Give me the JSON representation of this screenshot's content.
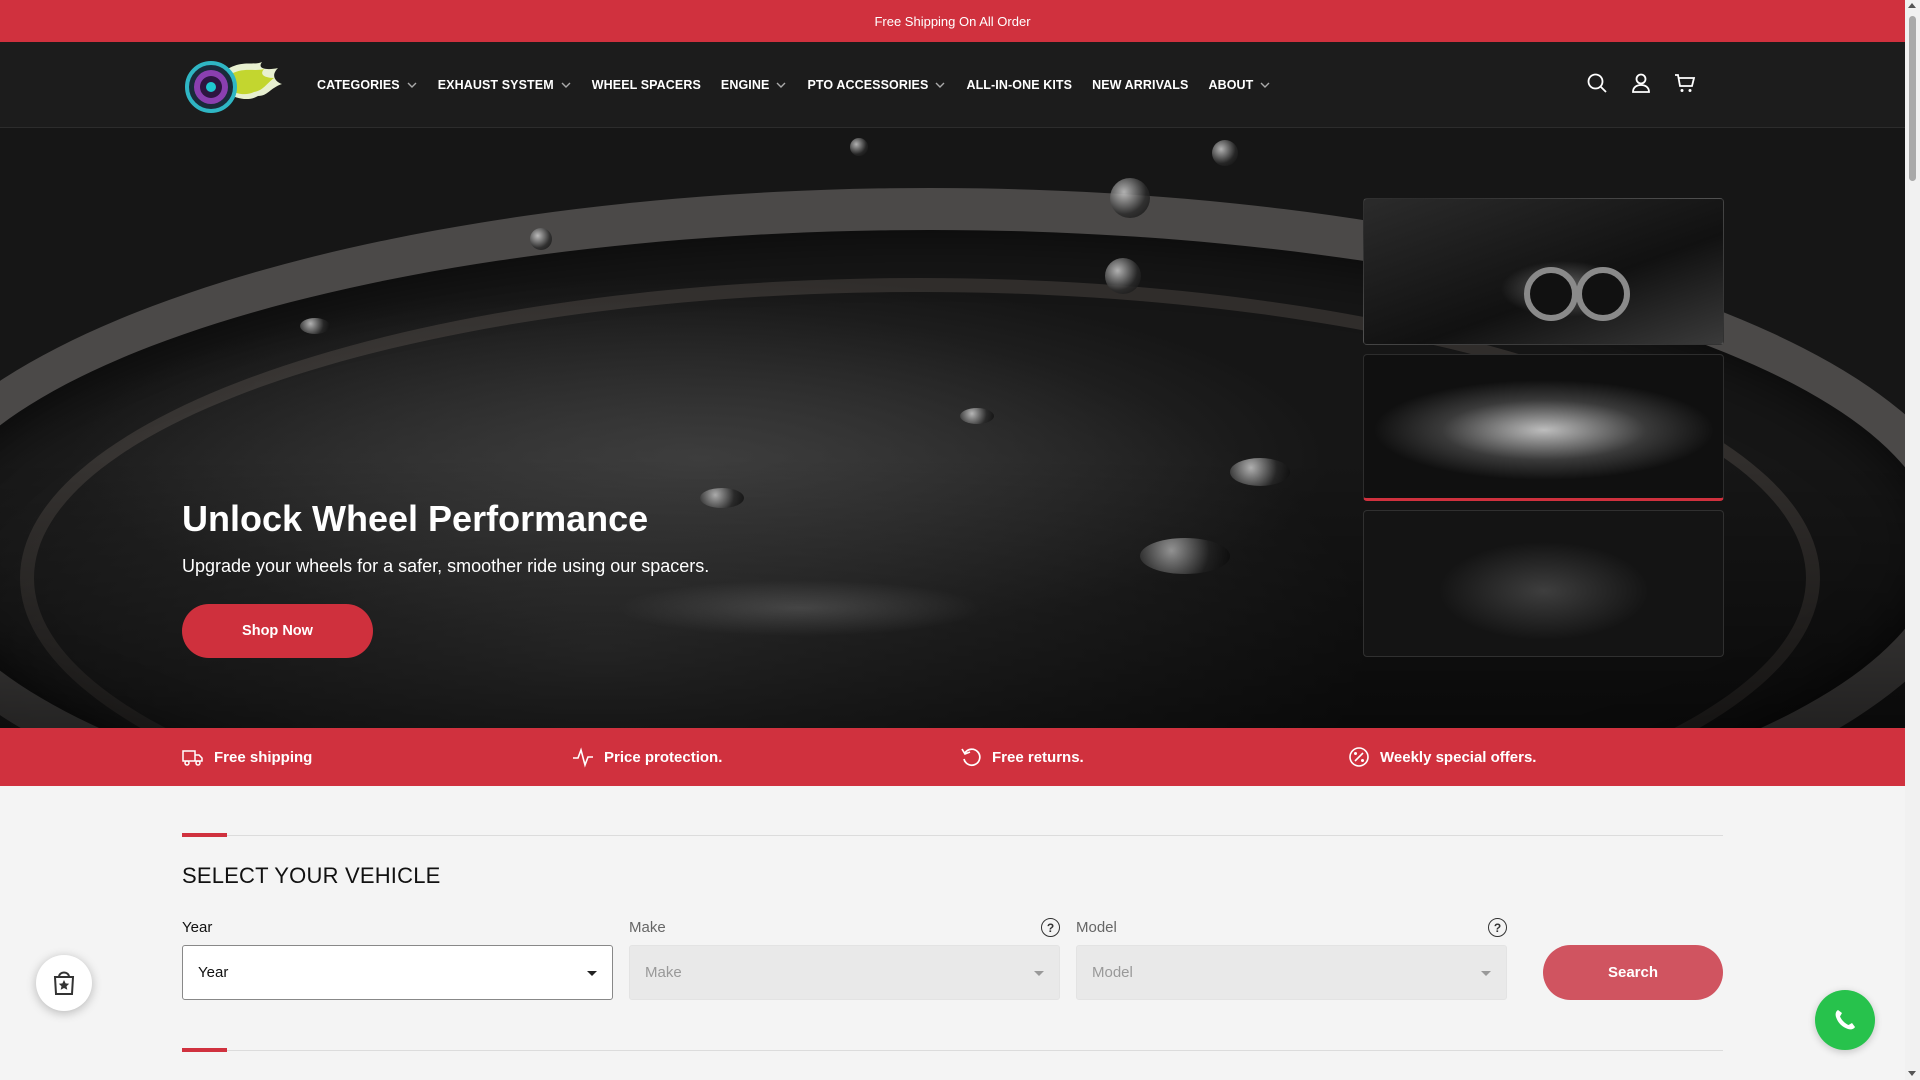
{
  "announcement": "Free Shipping On All Order",
  "nav": {
    "items": [
      {
        "label": "CATEGORIES",
        "dropdown": true
      },
      {
        "label": "EXHAUST SYSTEM",
        "dropdown": true
      },
      {
        "label": "WHEEL SPACERS",
        "dropdown": false
      },
      {
        "label": "ENGINE",
        "dropdown": true
      },
      {
        "label": "PTO ACCESSORIES",
        "dropdown": true
      },
      {
        "label": "ALL-IN-ONE KITS",
        "dropdown": false
      },
      {
        "label": "NEW ARRIVALS",
        "dropdown": false
      },
      {
        "label": "ABOUT",
        "dropdown": true
      }
    ],
    "icons": [
      "search-icon",
      "account-icon",
      "cart-icon"
    ]
  },
  "hero": {
    "title": "Unlock Wheel Performance",
    "subtitle": "Upgrade your wheels for a safer, smoother ride using our spacers.",
    "cta": "Shop Now",
    "thumbnails": [
      "exhaust-thumbnail",
      "wheel-thumbnail",
      "engine-thumbnail"
    ],
    "active_thumbnail": 1
  },
  "features": [
    {
      "label": "Free shipping",
      "icon": "truck-icon"
    },
    {
      "label": "Price protection.",
      "icon": "pulse-icon"
    },
    {
      "label": "Free returns.",
      "icon": "return-icon"
    },
    {
      "label": "Weekly special offers.",
      "icon": "percent-icon"
    }
  ],
  "vehicle": {
    "title": "SELECT YOUR VEHICLE",
    "year": {
      "label": "Year",
      "value": "Year"
    },
    "make": {
      "label": "Make",
      "value": "Make",
      "help": "?"
    },
    "model": {
      "label": "Model",
      "value": "Model",
      "help": "?"
    },
    "search": "Search"
  },
  "colors": {
    "accent": "#d0313e",
    "header_bg": "#1c1c1c",
    "whatsapp": "#27c24c"
  }
}
